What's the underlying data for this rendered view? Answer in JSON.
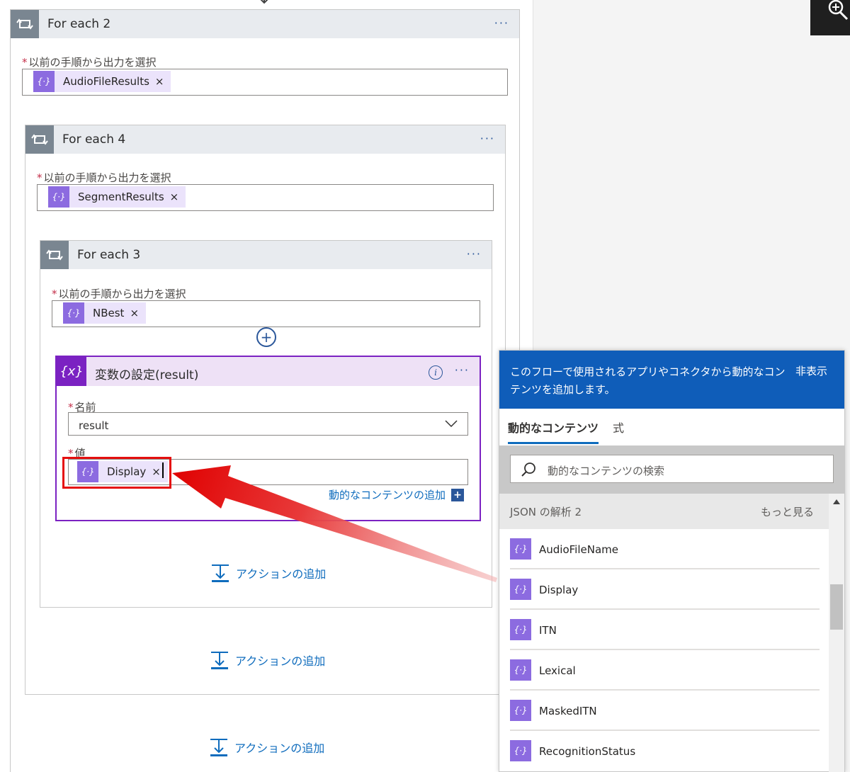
{
  "loops": {
    "for_each_2": {
      "title": "For each 2",
      "label": "以前の手順から出力を選択",
      "token": "AudioFileResults"
    },
    "for_each_4": {
      "title": "For each 4",
      "label": "以前の手順から出力を選択",
      "token": "SegmentResults"
    },
    "for_each_3": {
      "title": "For each 3",
      "label": "以前の手順から出力を選択",
      "token": "NBest"
    }
  },
  "set_variable": {
    "title": "変数の設定(result)",
    "name_label": "名前",
    "name_value": "result",
    "value_label": "値",
    "value_token": "Display",
    "add_dynamic_content": "動的なコンテンツの追加"
  },
  "add_action": "アクションの追加",
  "more_dots": "···",
  "token_close": "×",
  "required_star": "*",
  "dynamic_panel": {
    "description": "このフローで使用されるアプリやコネクタから動的なコンテンツを追加します。",
    "hide": "非表示",
    "tabs": {
      "dynamic": "動的なコンテンツ",
      "expression": "式"
    },
    "search_placeholder": "動的なコンテンツの検索",
    "section": {
      "title": "JSON の解析 2",
      "more": "もっと見る"
    },
    "items": [
      {
        "label": "AudioFileName"
      },
      {
        "label": "Display"
      },
      {
        "label": "ITN"
      },
      {
        "label": "Lexical"
      },
      {
        "label": "MaskedITN"
      },
      {
        "label": "RecognitionStatus"
      }
    ]
  },
  "colors": {
    "loop_header_bg": "#e8ebef",
    "loop_icon_bg": "#7a8691",
    "variable_accent": "#7b22c2",
    "token_icon": "#8c6be0",
    "panel_header": "#0f5db9",
    "link_blue": "#0f6cbd",
    "highlight_red": "#e50f0f"
  },
  "icons": {
    "loop": "loop-icon",
    "variable": "variable-icon",
    "token": "dynamic-token-icon",
    "search": "search-icon",
    "zoom": "zoom-in-icon",
    "add_action": "add-action-icon"
  }
}
